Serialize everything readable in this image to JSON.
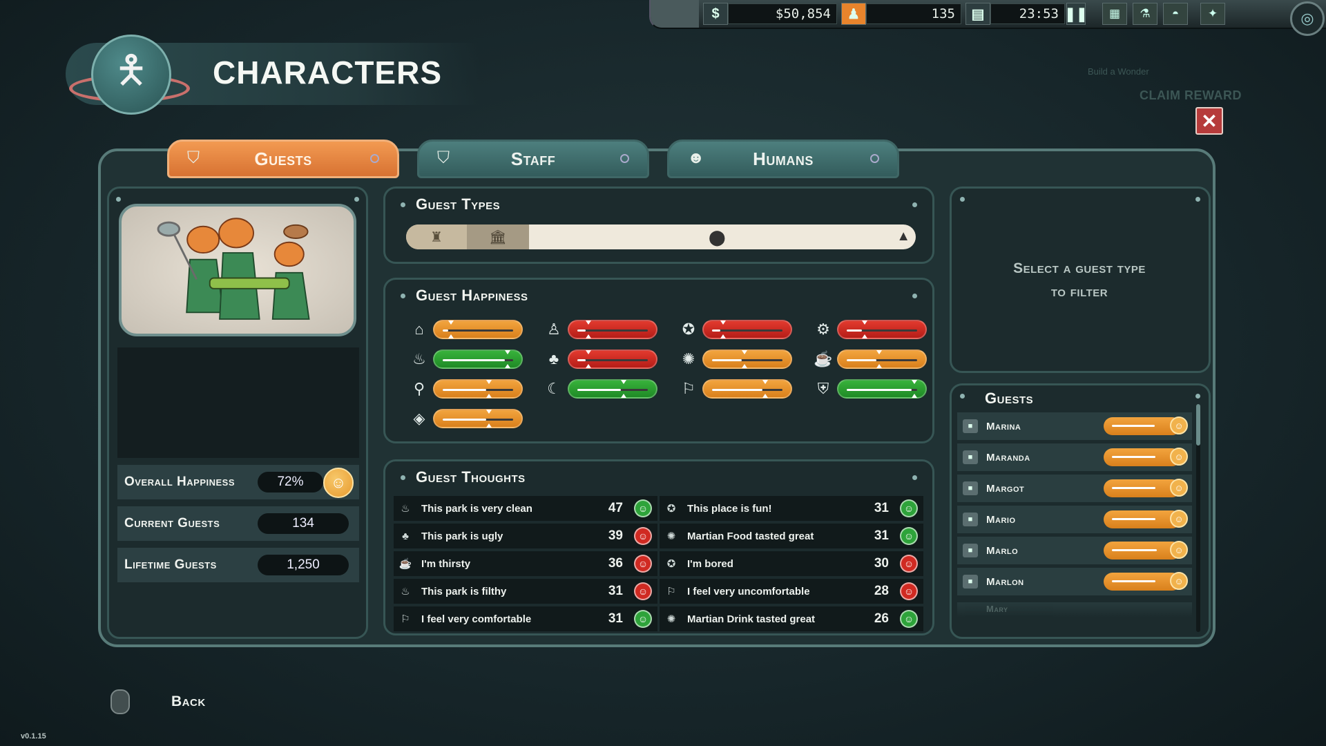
{
  "hud": {
    "money": "$50,854",
    "guest_count": "135",
    "time": "23:53",
    "icons": [
      "dollar-icon",
      "guest-icon",
      "clipboard-icon",
      "pause-icon",
      "build-icon",
      "research-icon",
      "ufo-icon",
      "settings-icon",
      "radar-icon"
    ]
  },
  "header": {
    "title": "CHARACTERS",
    "badge_icon": "character-badge-icon"
  },
  "ghost": {
    "subtitle": "Build a Wonder",
    "claim": "CLAIM REWARD"
  },
  "tabs": [
    {
      "label": "Guests",
      "icon": "guest-shield-icon",
      "active": true
    },
    {
      "label": "Staff",
      "icon": "staff-icon",
      "active": false
    },
    {
      "label": "Humans",
      "icon": "human-icon",
      "active": false
    }
  ],
  "stats": {
    "overall_happiness_label": "Overall Happiness",
    "overall_happiness": "72%",
    "current_guests_label": "Current Guests",
    "current_guests": "134",
    "lifetime_guests_label": "Lifetime Guests",
    "lifetime_guests": "1,250"
  },
  "guest_types": {
    "title": "Guest Types"
  },
  "happiness": {
    "title": "Guest Happiness",
    "meters": [
      {
        "icon": "park-icon",
        "color": "orange",
        "value": 0.08
      },
      {
        "icon": "staff-person-icon",
        "color": "red",
        "value": 0.12
      },
      {
        "icon": "attraction-icon",
        "color": "red",
        "value": 0.12
      },
      {
        "icon": "transport-icon",
        "color": "red",
        "value": 0.22
      },
      {
        "icon": "bath-icon",
        "color": "green",
        "value": 0.88
      },
      {
        "icon": "scenery-icon",
        "color": "red",
        "value": 0.12
      },
      {
        "icon": "food-icon",
        "color": "orange",
        "value": 0.42
      },
      {
        "icon": "drink-icon",
        "color": "orange",
        "value": 0.42
      },
      {
        "icon": "toilet-icon",
        "color": "orange",
        "value": 0.62
      },
      {
        "icon": "sleep-icon",
        "color": "green",
        "value": 0.62
      },
      {
        "icon": "comfort-icon",
        "color": "orange",
        "value": 0.72
      },
      {
        "icon": "security-icon",
        "color": "green",
        "value": 0.92
      },
      {
        "icon": "money-bag-icon",
        "color": "orange",
        "value": 0.62
      }
    ]
  },
  "thoughts": {
    "title": "Guest Thoughts",
    "items": [
      {
        "text": "This park is very clean",
        "count": "47",
        "mood": "good",
        "icon": "bath-icon"
      },
      {
        "text": "This place is fun!",
        "count": "31",
        "mood": "good",
        "icon": "fun-icon"
      },
      {
        "text": "This park is ugly",
        "count": "39",
        "mood": "bad",
        "icon": "scenery-icon"
      },
      {
        "text": "Martian Food tasted great",
        "count": "31",
        "mood": "good",
        "icon": "food-icon"
      },
      {
        "text": "I'm thirsty",
        "count": "36",
        "mood": "bad",
        "icon": "drink-icon"
      },
      {
        "text": "I'm bored",
        "count": "30",
        "mood": "bad",
        "icon": "fun-icon"
      },
      {
        "text": "This park is filthy",
        "count": "31",
        "mood": "bad",
        "icon": "bath-icon"
      },
      {
        "text": "I feel very uncomfortable",
        "count": "28",
        "mood": "bad",
        "icon": "comfort-icon"
      },
      {
        "text": "I feel very comfortable",
        "count": "31",
        "mood": "good",
        "icon": "comfort-icon"
      },
      {
        "text": "Martian Drink tasted great",
        "count": "26",
        "mood": "good",
        "icon": "food-icon"
      }
    ]
  },
  "filter_hint": {
    "line1": "Select a guest type",
    "line2": "to filter"
  },
  "guests": {
    "title": "Guests",
    "list": [
      {
        "name": "Marina",
        "happiness": 0.7
      },
      {
        "name": "Maranda",
        "happiness": 0.72
      },
      {
        "name": "Margot",
        "happiness": 0.72
      },
      {
        "name": "Mario",
        "happiness": 0.72
      },
      {
        "name": "Marlo",
        "happiness": 0.74
      },
      {
        "name": "Marlon",
        "happiness": 0.72
      }
    ],
    "partial": "Mary"
  },
  "footer": {
    "back_label": "Back",
    "version": "v0.1.15"
  },
  "colors": {
    "orange": "#e08a26",
    "red": "#c9271f",
    "green": "#2c9a32",
    "panel": "#1c2b2d"
  }
}
